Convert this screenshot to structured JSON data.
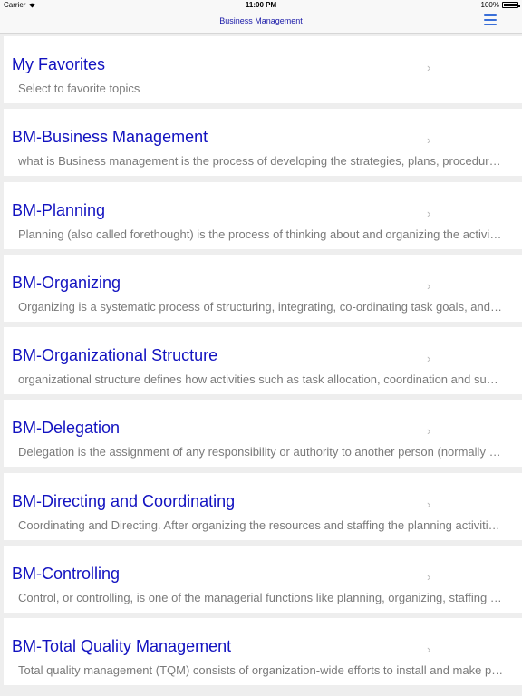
{
  "status_bar": {
    "carrier": "Carrier",
    "time": "11:00 PM",
    "battery": "100%"
  },
  "nav": {
    "title": "Business Management"
  },
  "topics": [
    {
      "title": "My Favorites",
      "subtitle": "Select to favorite topics"
    },
    {
      "title": "BM-Business Management",
      "subtitle": "what is Business management is the process of developing the strategies, plans, procedures and policies"
    },
    {
      "title": "BM-Planning",
      "subtitle": "Planning (also called forethought) is the process of thinking about and organizing the activities required"
    },
    {
      "title": "BM-Organizing",
      "subtitle": "Organizing is a systematic process of structuring, integrating, co-ordinating task goals, and activities"
    },
    {
      "title": "BM-Organizational Structure",
      "subtitle": "organizational structure defines how activities such as task allocation, coordination and supervision"
    },
    {
      "title": "BM-Delegation",
      "subtitle": "Delegation is the assignment of any responsibility or authority to another person (normally from a manager)"
    },
    {
      "title": "BM-Directing and Coordinating",
      "subtitle": "Coordinating and Directing. After organizing the resources and staffing the planning activities of the"
    },
    {
      "title": "BM-Controlling",
      "subtitle": "Control, or controlling, is one of the managerial functions like planning, organizing, staffing and directing"
    },
    {
      "title": "BM-Total Quality Management",
      "subtitle": "Total quality management (TQM) consists of organization-wide efforts to install and make permanent"
    }
  ],
  "chevron_glyph": "›"
}
